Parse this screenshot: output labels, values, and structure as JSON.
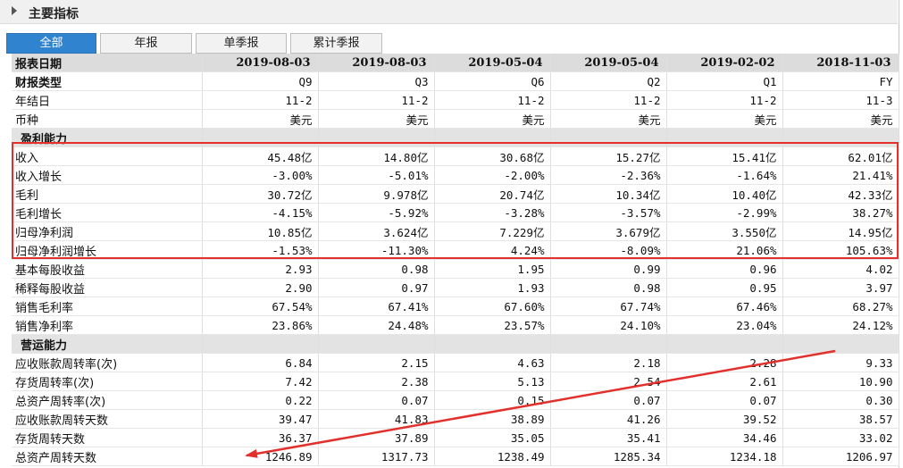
{
  "section": {
    "title": "主要指标"
  },
  "tabs": [
    "全部",
    "年报",
    "单季报",
    "累计季报"
  ],
  "header": {
    "label": "报表日期",
    "dates": [
      "2019-08-03",
      "2019-08-03",
      "2019-05-04",
      "2019-05-04",
      "2019-02-02",
      "2018-11-03"
    ]
  },
  "rows": [
    {
      "type": "bold",
      "label": "财报类型",
      "values": [
        "Q9",
        "Q3",
        "Q6",
        "Q2",
        "Q1",
        "FY"
      ]
    },
    {
      "type": "normal",
      "label": "年结日",
      "values": [
        "11-2",
        "11-2",
        "11-2",
        "11-2",
        "11-2",
        "11-3"
      ]
    },
    {
      "type": "normal",
      "label": "币种",
      "values": [
        "美元",
        "美元",
        "美元",
        "美元",
        "美元",
        "美元"
      ]
    },
    {
      "type": "group",
      "label": "盈利能力",
      "values": [
        "",
        "",
        "",
        "",
        "",
        ""
      ]
    },
    {
      "type": "normal",
      "label": "收入",
      "values": [
        "45.48亿",
        "14.80亿",
        "30.68亿",
        "15.27亿",
        "15.41亿",
        "62.01亿"
      ]
    },
    {
      "type": "normal",
      "label": "收入增长",
      "values": [
        "-3.00%",
        "-5.01%",
        "-2.00%",
        "-2.36%",
        "-1.64%",
        "21.41%"
      ]
    },
    {
      "type": "normal",
      "label": "毛利",
      "values": [
        "30.72亿",
        "9.978亿",
        "20.74亿",
        "10.34亿",
        "10.40亿",
        "42.33亿"
      ]
    },
    {
      "type": "normal",
      "label": "毛利增长",
      "values": [
        "-4.15%",
        "-5.92%",
        "-3.28%",
        "-3.57%",
        "-2.99%",
        "38.27%"
      ]
    },
    {
      "type": "normal",
      "label": "归母净利润",
      "values": [
        "10.85亿",
        "3.624亿",
        "7.229亿",
        "3.679亿",
        "3.550亿",
        "14.95亿"
      ]
    },
    {
      "type": "normal",
      "label": "归母净利润增长",
      "values": [
        "-1.53%",
        "-11.30%",
        "4.24%",
        "-8.09%",
        "21.06%",
        "105.63%"
      ]
    },
    {
      "type": "normal",
      "label": "基本每股收益",
      "values": [
        "2.93",
        "0.98",
        "1.95",
        "0.99",
        "0.96",
        "4.02"
      ]
    },
    {
      "type": "normal",
      "label": "稀释每股收益",
      "values": [
        "2.90",
        "0.97",
        "1.93",
        "0.98",
        "0.95",
        "3.97"
      ]
    },
    {
      "type": "normal",
      "label": "销售毛利率",
      "values": [
        "67.54%",
        "67.41%",
        "67.60%",
        "67.74%",
        "67.46%",
        "68.27%"
      ]
    },
    {
      "type": "normal",
      "label": "销售净利率",
      "values": [
        "23.86%",
        "24.48%",
        "23.57%",
        "24.10%",
        "23.04%",
        "24.12%"
      ]
    },
    {
      "type": "group",
      "label": "营运能力",
      "values": [
        "",
        "",
        "",
        "",
        "",
        ""
      ]
    },
    {
      "type": "normal",
      "label": "应收账款周转率(次)",
      "values": [
        "6.84",
        "2.15",
        "4.63",
        "2.18",
        "2.28",
        "9.33"
      ]
    },
    {
      "type": "normal",
      "label": "存货周转率(次)",
      "values": [
        "7.42",
        "2.38",
        "5.13",
        "2.54",
        "2.61",
        "10.90"
      ]
    },
    {
      "type": "normal",
      "label": "总资产周转率(次)",
      "values": [
        "0.22",
        "0.07",
        "0.15",
        "0.07",
        "0.07",
        "0.30"
      ]
    },
    {
      "type": "normal",
      "label": "应收账款周转天数",
      "values": [
        "39.47",
        "41.83",
        "38.89",
        "41.26",
        "39.52",
        "38.57"
      ]
    },
    {
      "type": "normal",
      "label": "存货周转天数",
      "values": [
        "36.37",
        "37.89",
        "35.05",
        "35.41",
        "34.46",
        "33.02"
      ]
    },
    {
      "type": "normal",
      "label": "总资产周转天数",
      "values": [
        "1246.89",
        "1317.73",
        "1238.49",
        "1285.34",
        "1234.18",
        "1206.97"
      ]
    }
  ],
  "annotation": {
    "highlight_color": "#e2302c"
  }
}
